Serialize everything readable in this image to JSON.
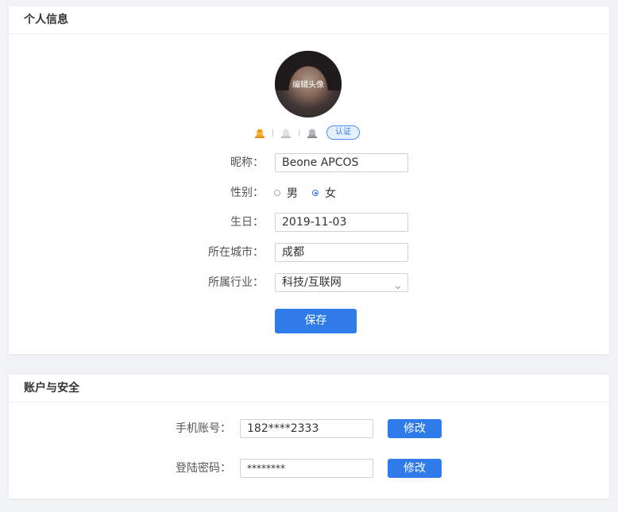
{
  "profile": {
    "title": "个人信息",
    "avatar_label": "编辑头像",
    "verify_tag": "认证",
    "fields": {
      "nickname_label": "昵称：",
      "nickname_value": "Beone  APCOS",
      "gender_label": "性别：",
      "gender_male": "男",
      "gender_female": "女",
      "gender_selected": "女",
      "birthday_label": "生日：",
      "birthday_value": "2019-11-03",
      "city_label": "所在城市：",
      "city_value": "成都",
      "industry_label": "所属行业：",
      "industry_value": "科技/互联网"
    },
    "save_label": "保存"
  },
  "account": {
    "title": "账户与安全",
    "phone_label": "手机账号：",
    "phone_value": "182****2333",
    "phone_edit": "修改",
    "password_label": "登陆密码：",
    "password_value": "********",
    "password_edit": "修改"
  },
  "icons": [
    "gold-medal-icon",
    "silver-medal-icon",
    "bronze-medal-icon",
    "chevron-down-icon"
  ],
  "colors": {
    "accent": "#2f7bea",
    "background": "#f2f3f5",
    "gold": "#f5a623"
  }
}
